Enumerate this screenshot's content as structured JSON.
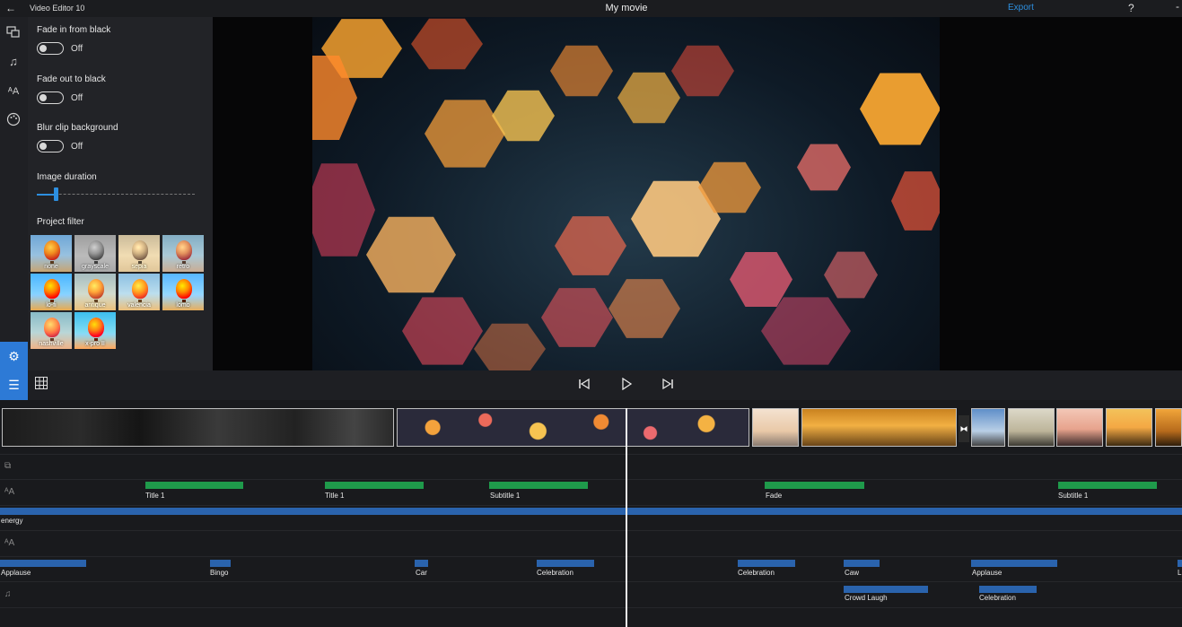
{
  "app": {
    "name": "Video Editor 10",
    "project_title": "My movie",
    "export_label": "Export",
    "help_label": "?"
  },
  "icons": {
    "back": "back-arrow-icon",
    "help": "help-icon"
  },
  "rail": {
    "items": [
      "media-icon",
      "music-icon",
      "text-icon",
      "palette-icon"
    ],
    "settings_icon": "gear-icon"
  },
  "settings": {
    "fade_in": {
      "label": "Fade in from black",
      "state": "Off"
    },
    "fade_out": {
      "label": "Fade out to black",
      "state": "Off"
    },
    "blur": {
      "label": "Blur clip background",
      "state": "Off"
    },
    "image_duration": {
      "label": "Image duration",
      "value_fraction": 0.12
    },
    "project_filter": {
      "label": "Project filter",
      "filters": [
        "none",
        "grayscale",
        "sepia",
        "retro",
        "lo-fi",
        "antique",
        "valencia",
        "lomo",
        "nashville",
        "x-pro II"
      ]
    }
  },
  "controls": {
    "storyboard_icon": "list-icon",
    "grid_icon": "grid-icon",
    "prev_icon": "skip-previous-icon",
    "play_icon": "play-icon",
    "next_icon": "skip-next-icon"
  },
  "tracks": {
    "title_track": [
      "Title 1",
      "Title 1",
      "Subtitle 1",
      "Fade",
      "Subtitle 1"
    ],
    "music_track": [
      "energy"
    ],
    "sound_track": [
      "Applause",
      "Bingo",
      "Car",
      "Celebration",
      "Celebration",
      "Caw",
      "Applause",
      "L"
    ],
    "sound_track_2": [
      "Crowd Laugh",
      "Celebration"
    ]
  },
  "colors": {
    "accent": "#2d7ad6",
    "export": "#2d8fe0",
    "title_bar": "#1f9a4b",
    "audio_bar": "#2a63ad"
  }
}
